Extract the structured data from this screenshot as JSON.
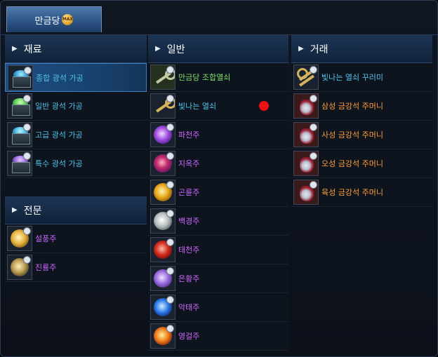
{
  "tab": {
    "label": "만금당",
    "badge": "MAX"
  },
  "columns": {
    "material": {
      "title": "재료",
      "items": [
        {
          "label": "종합 광석 가공",
          "icon": "ore-cart-icon",
          "color": "blue",
          "selected": true
        },
        {
          "label": "일반 광석 가공",
          "icon": "ore-cart-icon",
          "color": "blue"
        },
        {
          "label": "고급 광석 가공",
          "icon": "ore-cart-icon",
          "color": "blue"
        },
        {
          "label": "특수 광석 가공",
          "icon": "ore-cart-icon",
          "color": "blue"
        }
      ]
    },
    "special": {
      "title": "전문",
      "items": [
        {
          "label": "설풍주",
          "icon": "orb-icon",
          "color": "purple"
        },
        {
          "label": "진룡주",
          "icon": "orb-icon",
          "color": "purple"
        }
      ]
    },
    "general": {
      "title": "일반",
      "items": [
        {
          "label": "만금당 조합열쇠",
          "icon": "key-icon",
          "color": "green"
        },
        {
          "label": "빛나는 열쇠",
          "icon": "key-icon",
          "color": "blue",
          "notification": true
        },
        {
          "label": "파천주",
          "icon": "orb-icon",
          "color": "purple"
        },
        {
          "label": "지옥주",
          "icon": "orb-icon",
          "color": "purple"
        },
        {
          "label": "곤륜주",
          "icon": "orb-icon",
          "color": "purple"
        },
        {
          "label": "백경주",
          "icon": "orb-icon",
          "color": "purple"
        },
        {
          "label": "태천주",
          "icon": "orb-icon",
          "color": "purple"
        },
        {
          "label": "은황주",
          "icon": "orb-icon",
          "color": "purple"
        },
        {
          "label": "악태주",
          "icon": "orb-icon",
          "color": "purple"
        },
        {
          "label": "영걸주",
          "icon": "orb-icon",
          "color": "purple"
        }
      ]
    },
    "trade": {
      "title": "거래",
      "items": [
        {
          "label": "빛나는 열쇠 꾸러미",
          "icon": "key-bundle-icon",
          "color": "blue"
        },
        {
          "label": "삼성 금강석 주머니",
          "icon": "pouch-icon",
          "color": "orange"
        },
        {
          "label": "사성 금강석 주머니",
          "icon": "pouch-icon",
          "color": "orange"
        },
        {
          "label": "오성 금강석 주머니",
          "icon": "pouch-icon",
          "color": "orange"
        },
        {
          "label": "육성 금강석 주머니",
          "icon": "pouch-icon",
          "color": "orange"
        }
      ]
    }
  },
  "colors": {
    "blue": "#4fc3e8",
    "purple": "#cc66ff",
    "green": "#7ee06a",
    "orange": "#ff9d3a",
    "notification": "#ee1111"
  }
}
